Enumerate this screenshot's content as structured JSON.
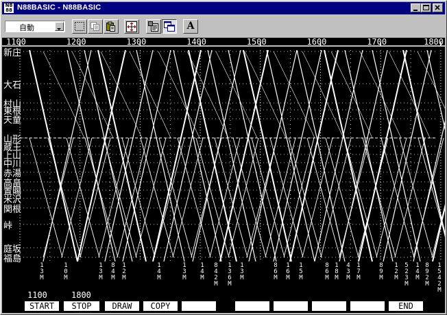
{
  "window": {
    "title": "N88BASIC - N88BASIC",
    "icon_text": "N8 88",
    "buttons": [
      "minimize-icon",
      "maximize-icon",
      "close-icon"
    ]
  },
  "toolbar": {
    "mode_value": "自動",
    "tools": [
      "select-rect-icon",
      "copy-icon",
      "paste-icon",
      "fullscreen-icon",
      "properties-icon",
      "window-mode-icon",
      "font-icon"
    ],
    "font_label": "A"
  },
  "graph": {
    "time_labels": [
      "1100",
      "1200",
      "1300",
      "1400",
      "1500",
      "1600",
      "1700",
      "1800"
    ],
    "stations": [
      "新庄",
      "大石",
      "村山",
      "東根",
      "天童",
      "山形",
      "蔵王",
      "上山",
      "中川",
      "赤湯",
      "高畠",
      "置賜",
      "米沢",
      "関根",
      "峠",
      "庭坂",
      "福島"
    ],
    "train_labels": [
      "1 3 M",
      "1 0 M",
      "1 3 M",
      "8 4 M",
      "1 2 M",
      "1 4 M",
      "1 3 M",
      "1 4 M",
      "8 4 2 M",
      "1 3 6 M",
      "1 3 M",
      "8 6 M",
      "1 6 M",
      "1 5 M",
      "8 6 M",
      "1 8 M",
      "4 3 M",
      "1 7 M",
      "8 9 M",
      "1 2 M",
      "5 2 3 M",
      "1 4 M",
      "8 9 2 M",
      "1 5 4 2 M"
    ],
    "colors": {
      "background": "#000000",
      "lines": "#ffffff"
    }
  },
  "fkeys": {
    "range_start": "1100",
    "range_end": "1800",
    "labels": [
      "START",
      "STOP",
      "DRAW",
      "COPY",
      "",
      "",
      "",
      "",
      "",
      "END"
    ]
  }
}
